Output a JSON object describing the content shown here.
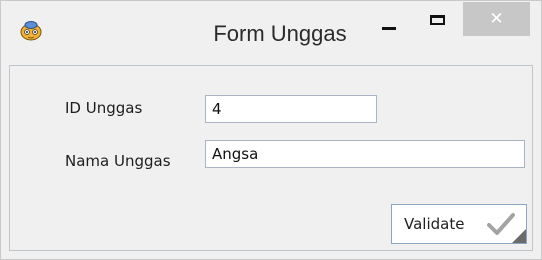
{
  "window": {
    "title": "Form Unggas",
    "icon": "app-logo-icon",
    "close_label": "✕"
  },
  "form": {
    "id_label": "ID Unggas",
    "id_value": "4",
    "nama_label": "Nama Unggas",
    "nama_value": "Angsa",
    "validate_label": "Validate",
    "validate_icon": "check-icon"
  }
}
